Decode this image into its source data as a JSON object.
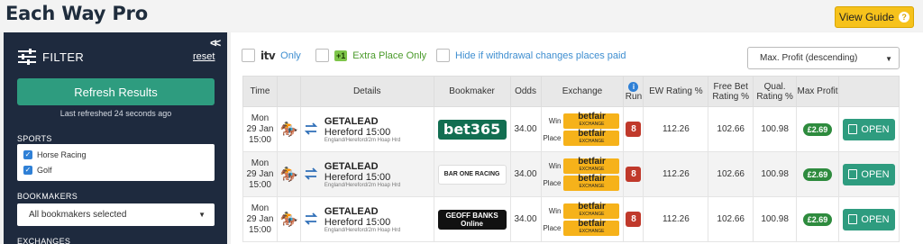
{
  "header": {
    "title": "Each Way Pro",
    "view_guide_label": "View Guide",
    "view_guide_icon": "question-icon"
  },
  "sidebar": {
    "filter_label": "FILTER",
    "reset_label": "reset",
    "refresh_label": "Refresh Results",
    "last_refreshed": "Last refreshed 24 seconds ago",
    "sports_label": "SPORTS",
    "sports": [
      {
        "label": "Horse Racing",
        "checked": true
      },
      {
        "label": "Golf",
        "checked": true
      }
    ],
    "bookmakers_label": "BOOKMAKERS",
    "bookmakers_selected": "All bookmakers selected",
    "exchanges_label": "EXCHANGES"
  },
  "options": {
    "itv_logo": "itv",
    "itv_only": "Only",
    "extra_place_badge": "+1",
    "extra_place_only": "Extra Place Only",
    "hide_withdrawal": "Hide if withdrawal changes places paid",
    "sort": "Max. Profit (descending)"
  },
  "table": {
    "headers": [
      "Time",
      "",
      "Details",
      "Bookmaker",
      "Odds",
      "Exchange",
      "Run",
      "EW Rating %",
      "Free Bet Rating %",
      "Qual. Rating %",
      "Max Profit",
      ""
    ],
    "win_label": "Win",
    "place_label": "Place",
    "exchange_name": "betfair",
    "exchange_sub": "EXCHANGE",
    "open_label": "OPEN",
    "rows": [
      {
        "day": "Mon",
        "date": "29 Jan",
        "time": "15:00",
        "runner": "GETALEAD",
        "race": "Hereford 15:00",
        "course": "England/Hereford/2m Hoap Hrd",
        "bookmaker": "bet365",
        "odds": "34.00",
        "run": "8",
        "ew_rating": "112.26",
        "free_bet_rating": "102.66",
        "qual_rating": "100.98",
        "max_profit": "£2.69"
      },
      {
        "day": "Mon",
        "date": "29 Jan",
        "time": "15:00",
        "runner": "GETALEAD",
        "race": "Hereford 15:00",
        "course": "England/Hereford/2m Hoap Hrd",
        "bookmaker": "BAR ONE RACING",
        "odds": "34.00",
        "run": "8",
        "ew_rating": "112.26",
        "free_bet_rating": "102.66",
        "qual_rating": "100.98",
        "max_profit": "£2.69"
      },
      {
        "day": "Mon",
        "date": "29 Jan",
        "time": "15:00",
        "runner": "GETALEAD",
        "race": "Hereford 15:00",
        "course": "England/Hereford/2m Hoap Hrd",
        "bookmaker": "GEOFF BANKS Online",
        "odds": "34.00",
        "run": "8",
        "ew_rating": "112.26",
        "free_bet_rating": "102.66",
        "qual_rating": "100.98",
        "max_profit": "£2.69"
      }
    ]
  }
}
